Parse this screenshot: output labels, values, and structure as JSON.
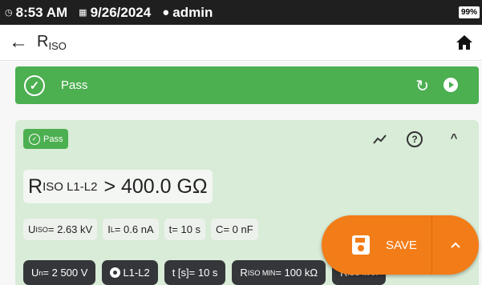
{
  "status_bar": {
    "time": "8:53 AM",
    "date": "9/26/2024",
    "user": "admin",
    "battery": "99%"
  },
  "app_bar": {
    "title_main": "R",
    "title_sub": "ISO"
  },
  "banner": {
    "label": "Pass",
    "color": "#4caf50"
  },
  "card": {
    "chip_label": "Pass",
    "result_symbol": "R",
    "result_sub": "ISO L1-L2",
    "result_value": "> 400.0 GΩ",
    "params": [
      {
        "sym": "U",
        "sub": "ISO",
        "val": " = 2.63 kV"
      },
      {
        "sym": "I",
        "sub": "L",
        "val": " = 0.6 nA"
      },
      {
        "sym": "t",
        "sub": "",
        "val": " = 10 s"
      },
      {
        "sym": "C",
        "sub": "",
        "val": " = 0 nF"
      }
    ],
    "settings": [
      {
        "sym": "U",
        "sub": "n",
        "val": " = 2 500 V"
      },
      {
        "sym": "",
        "sub": "",
        "val": "L1-L2"
      },
      {
        "sym": "t [s]",
        "sub": "",
        "val": " = 10 s"
      },
      {
        "sym": "R",
        "sub": "ISO MIN",
        "val": " = 100 kΩ"
      },
      {
        "sym": "R",
        "sub": "ISO MAX",
        "val": ""
      }
    ]
  },
  "fab": {
    "save_label": "SAVE",
    "color": "#f27c17"
  },
  "icons": {
    "back": "arrow-left",
    "home": "home",
    "retry": "retry",
    "play": "play",
    "trend": "trend-line",
    "help": "help",
    "collapse": "chevron-up",
    "save": "floppy",
    "expand": "chevron-up"
  }
}
